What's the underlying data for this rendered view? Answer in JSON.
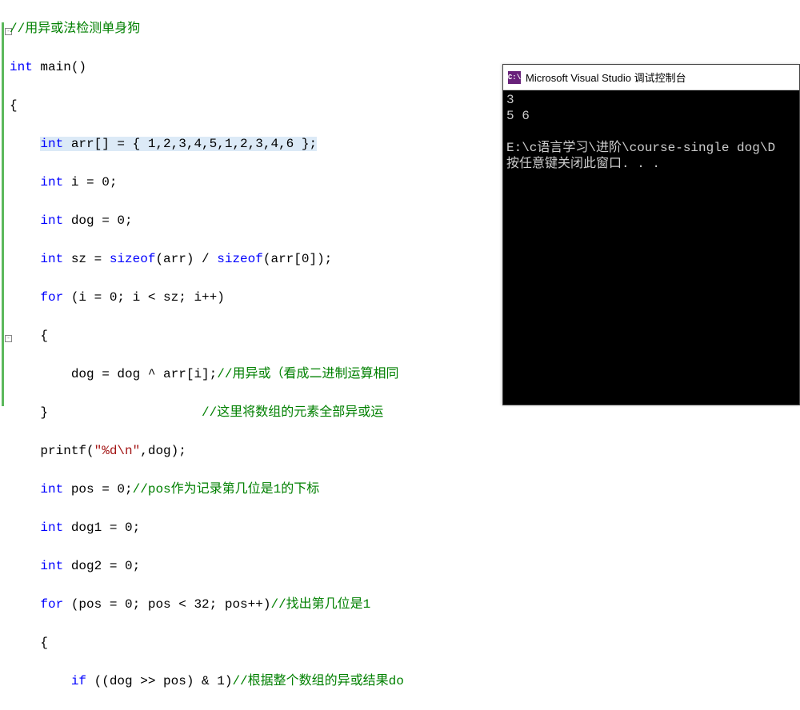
{
  "code": {
    "l1_comment": "//用异或法检测单身狗",
    "l2_kw": "int",
    "l2_fn": " main()",
    "l3": "{",
    "l4_kw": "int",
    "l4_rest": " arr[] = { 1,2,3,4,5,1,2,3,4,6 };",
    "l5_kw": "int",
    "l5_rest": " i = 0;",
    "l6_kw": "int",
    "l6_rest": " dog = 0;",
    "l7_kw1": "int",
    "l7_mid": " sz = ",
    "l7_kw2": "sizeof",
    "l7_p1": "(arr) / ",
    "l7_kw3": "sizeof",
    "l7_p2": "(arr[0]);",
    "l8_kw": "for",
    "l8_rest": " (i = 0; i < sz; i++)",
    "l9": "{",
    "l10_code": "        dog = dog ^ arr[i];",
    "l10_comment": "//用异或（看成二进制运算相同",
    "l11_close": "}",
    "l11_comment": "//这里将数组的元素全部异或运",
    "l12_pre": "printf(",
    "l12_str": "\"%d\\n\"",
    "l12_post": ",dog);",
    "l13_kw": "int",
    "l13_rest": " pos = 0;",
    "l13_comment": "//pos作为记录第几位是1的下标",
    "l14_kw": "int",
    "l14_rest": " dog1 = 0;",
    "l15_kw": "int",
    "l15_rest": " dog2 = 0;",
    "l16_kw": "for",
    "l16_rest": " (pos = 0; pos < 32; pos++)",
    "l16_comment": "//找出第几位是1",
    "l17": "{",
    "l18_kw": "if",
    "l18_rest": " ((dog >> pos) & 1)",
    "l18_comment": "//根据整个数组的异或结果do"
  },
  "console": {
    "icon_text": "C:\\",
    "title": "Microsoft Visual Studio 调试控制台",
    "out_line1": "3",
    "out_line2": "5 6",
    "out_blank": "",
    "out_path": "E:\\c语言学习\\进阶\\course-single dog\\D",
    "out_prompt": "按任意键关闭此窗口. . ."
  }
}
